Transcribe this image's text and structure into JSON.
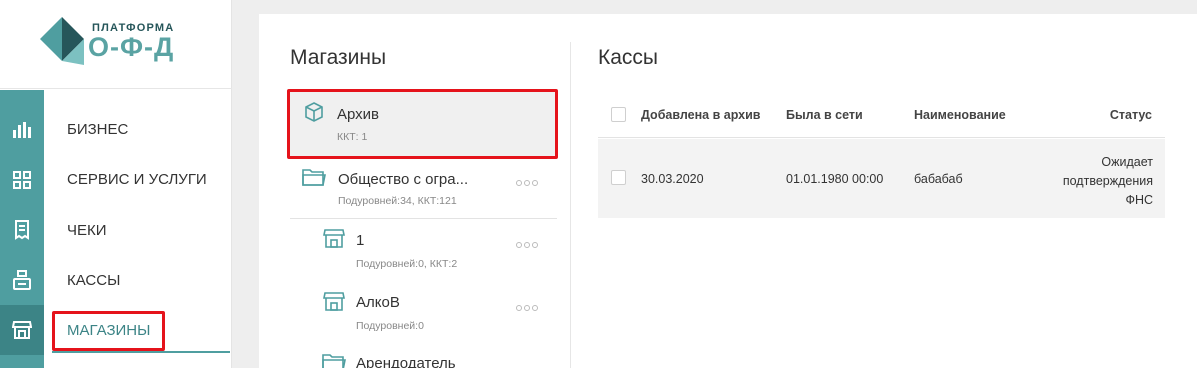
{
  "brand": {
    "top": "ПЛАТФОРМА",
    "bottom": "О-Ф-Д"
  },
  "nav": {
    "items": [
      {
        "label": "БИЗНЕС",
        "icon": "bar-chart-icon"
      },
      {
        "label": "СЕРВИС И УСЛУГИ",
        "icon": "grid-icon"
      },
      {
        "label": "ЧЕКИ",
        "icon": "receipt-icon"
      },
      {
        "label": "КАССЫ",
        "icon": "cash-register-icon"
      },
      {
        "label": "МАГАЗИНЫ",
        "icon": "store-icon"
      }
    ],
    "active": "МАГАЗИНЫ"
  },
  "stores": {
    "title": "Магазины",
    "items": [
      {
        "name": "Архив",
        "sub": "ККТ: 1",
        "icon": "box-icon",
        "selected": true
      },
      {
        "name": "Общество с огра...",
        "sub": "Подуровней:34, ККТ:121",
        "icon": "folder-icon"
      },
      {
        "name": "1",
        "sub": "Подуровней:0, ККТ:2",
        "icon": "store-icon"
      },
      {
        "name": "АлкоВ",
        "sub": "Подуровней:0",
        "icon": "store-icon"
      },
      {
        "name": "Арендодатель",
        "sub": "",
        "icon": "folder-icon"
      }
    ]
  },
  "registers": {
    "title": "Кассы",
    "columns": [
      "Добавлена в архив",
      "Была в сети",
      "Наименование",
      "Статус"
    ],
    "rows": [
      {
        "added": "30.03.2020",
        "online": "01.01.1980 00:00",
        "name": "бабабаб",
        "status": [
          "Ожидает",
          "подтверждения",
          "ФНС"
        ]
      }
    ]
  },
  "colors": {
    "accent": "#4f9ea0",
    "accent_dark": "#3c8486",
    "highlight": "#e5131b"
  }
}
